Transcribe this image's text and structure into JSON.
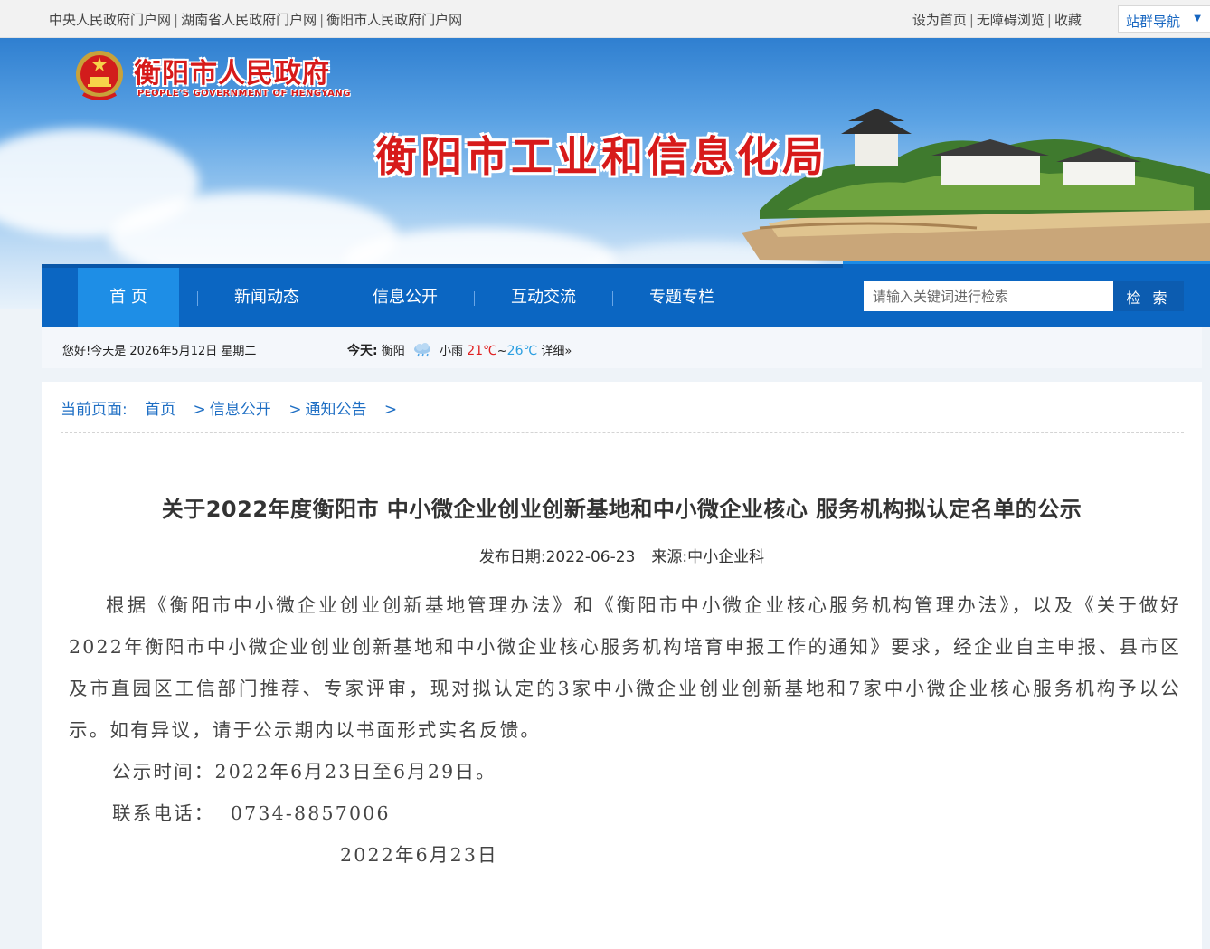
{
  "topbar": {
    "links_left": [
      "中央人民政府门户网",
      "湖南省人民政府门户网",
      "衡阳市人民政府门户网"
    ],
    "links_right": [
      "设为首页",
      "无障碍浏览",
      "收藏"
    ],
    "site_nav": "站群导航"
  },
  "banner": {
    "gov_title": "衡阳市人民政府",
    "gov_subtitle": "PEOPLE'S GOVERNMENT OF HENGYANG",
    "bureau_title": "衡阳市工业和信息化局"
  },
  "nav": {
    "items": [
      "首 页",
      "新闻动态",
      "信息公开",
      "互动交流",
      "专题专栏"
    ],
    "active": "首 页"
  },
  "search": {
    "placeholder": "请输入关键词进行检索",
    "button": "检 索"
  },
  "infobar": {
    "date_text": "您好!今天是 2026年5月12日  星期二",
    "today_label": "今天:",
    "city": "衡阳",
    "condition": "小雨",
    "temp_low": "21℃",
    "temp_sep": "~",
    "temp_high": "26℃",
    "detail": "详细»"
  },
  "breadcrumb": {
    "label": "当前页面:",
    "items": [
      "首页",
      "信息公开",
      "通知公告"
    ],
    "sep": ">"
  },
  "article": {
    "title": "关于2022年度衡阳市 中小微企业创业创新基地和中小微企业核心 服务机构拟认定名单的公示",
    "date_label": "发布日期:",
    "date": "2022-06-23",
    "source_label": "来源:",
    "source": "中小企业科",
    "paragraph": "根据《衡阳市中小微企业创业创新基地管理办法》和《衡阳市中小微企业核心服务机构管理办法》，以及《关于做好2022年衡阳市中小微企业创业创新基地和中小微企业核心服务机构培育申报工作的通知》要求，经企业自主申报、县市区及市直园区工信部门推荐、专家评审，现对拟认定的3家中小微企业创业创新基地和7家中小微企业核心服务机构予以公示。如有异议，请于公示期内以书面形式实名反馈。",
    "period": "公示时间：2022年6月23日至6月29日。",
    "phone": "联系电话：  0734-8857006",
    "sign_date": "2022年6月23日"
  },
  "colors": {
    "nav_bg": "#0b66c2",
    "nav_active": "#1e8ee6",
    "title_red": "#d71a1a",
    "link_blue": "#1f6fc4"
  }
}
